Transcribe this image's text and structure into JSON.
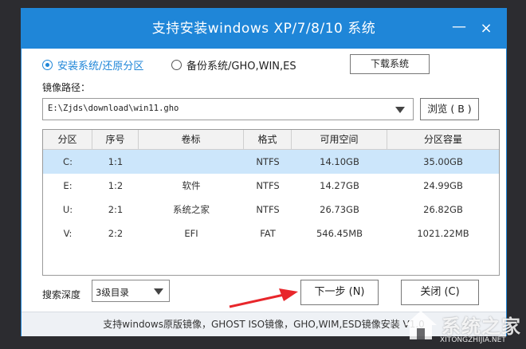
{
  "window": {
    "title": "支持安装windows XP/7/8/10 系统",
    "minimize": "—",
    "close": "×"
  },
  "mode": {
    "install_label": "安装系统/还原分区",
    "backup_label": "备份系统/GHO,WIN,ES",
    "selected": "install"
  },
  "download_button": "下载系统",
  "image_path": {
    "label": "镜像路径：",
    "value": "E:\\Zjds\\download\\win11.gho",
    "browse_label": "浏览 ( B )"
  },
  "partition_table": {
    "columns": [
      "分区",
      "序号",
      "卷标",
      "格式",
      "可用空间",
      "分区容量"
    ],
    "rows": [
      [
        "C:",
        "1:1",
        "",
        "NTFS",
        "14.10GB",
        "35.00GB"
      ],
      [
        "E:",
        "1:2",
        "软件",
        "NTFS",
        "14.27GB",
        "24.99GB"
      ],
      [
        "U:",
        "2:1",
        "系统之家",
        "NTFS",
        "26.73GB",
        "26.82GB"
      ],
      [
        "V:",
        "2:2",
        "EFI",
        "FAT",
        "546.45MB",
        "1021.22MB"
      ]
    ],
    "selected_row": 0
  },
  "search_depth": {
    "label": "搜索深度",
    "value": "3级目录"
  },
  "buttons": {
    "next": "下一步 (N)",
    "close": "关闭 (C)"
  },
  "footer": {
    "text": "支持windows原版镜像，GHOST ISO镜像，GHO,WIM,ESD镜像安装   V1.0"
  },
  "watermark": {
    "text": "系统之家",
    "url": "XITONGZHIJIA.NET"
  },
  "colors": {
    "accent": "#1f86d8",
    "selected_row": "#cce6fb",
    "annotation_arrow": "#e8262b"
  }
}
